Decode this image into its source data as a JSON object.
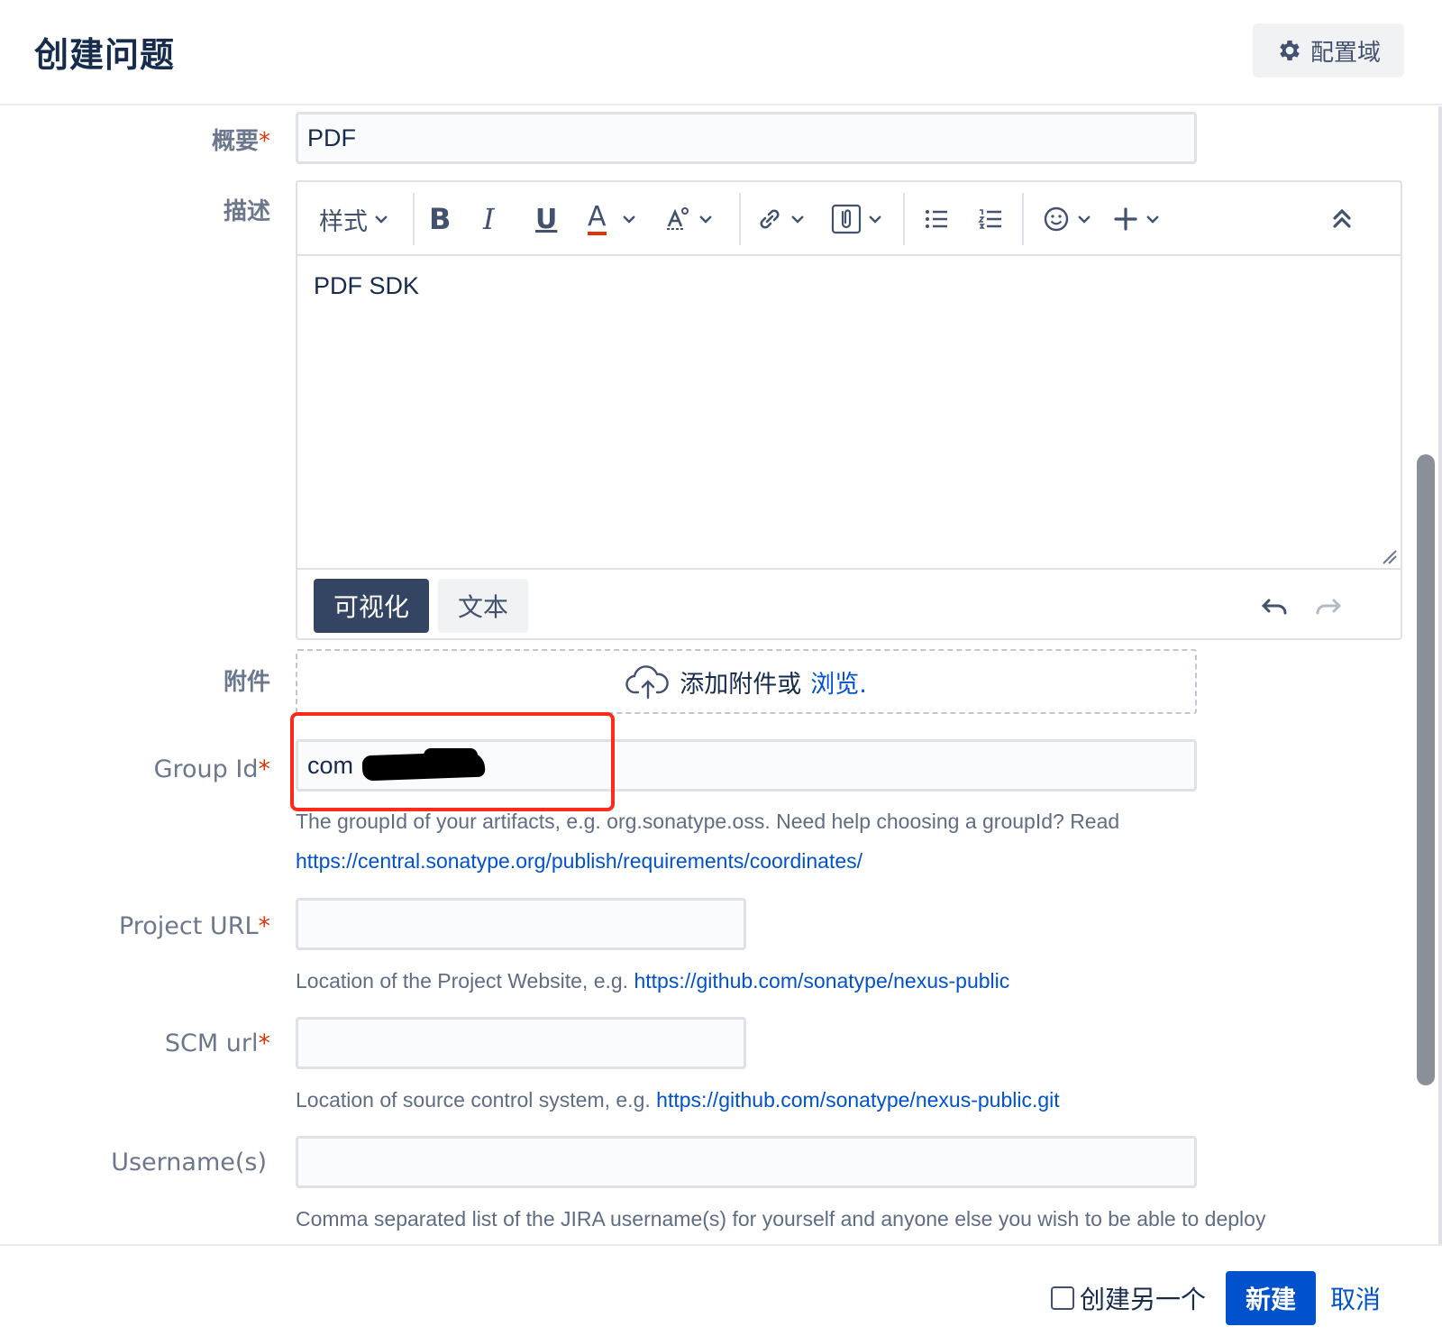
{
  "header": {
    "title": "创建问题",
    "config_label": "配置域"
  },
  "fields": {
    "summary": {
      "label": "概要",
      "required_mark": "*",
      "value": "PDF"
    },
    "description": {
      "label": "描述",
      "toolbar": {
        "style_label": "样式",
        "bold": "B",
        "italic": "I",
        "underline": "U",
        "text_color": "A"
      },
      "body": "PDF SDK",
      "mode_visual": "可视化",
      "mode_text": "文本"
    },
    "attachment": {
      "label": "附件",
      "drop_text": "添加附件或",
      "browse_link": "浏览."
    },
    "group_id": {
      "label": "Group Id",
      "required_mark": "*",
      "value": "com",
      "help_text": "The groupId of your artifacts, e.g. org.sonatype.oss. Need help choosing a groupId? Read",
      "help_link": "https://central.sonatype.org/publish/requirements/coordinates/"
    },
    "project_url": {
      "label": "Project URL",
      "required_mark": "*",
      "value": "",
      "help_text": "Location of the Project Website, e.g.",
      "help_link": "https://github.com/sonatype/nexus-public"
    },
    "scm_url": {
      "label": "SCM url",
      "required_mark": "*",
      "value": "",
      "help_text": "Location of source control system, e.g.",
      "help_link": "https://github.com/sonatype/nexus-public.git"
    },
    "usernames": {
      "label": "Username(s)",
      "value": "",
      "help_text": "Comma separated list of the JIRA username(s) for yourself and anyone else you wish to be able to deploy"
    }
  },
  "footer": {
    "create_another": "创建另一个",
    "create_another_checked": false,
    "create_label": "新建",
    "cancel_label": "取消"
  },
  "colors": {
    "primary": "#0052cc",
    "required": "#de350b",
    "annotation_box": "#ff2a1a",
    "visual_mode_bg": "#344563"
  }
}
